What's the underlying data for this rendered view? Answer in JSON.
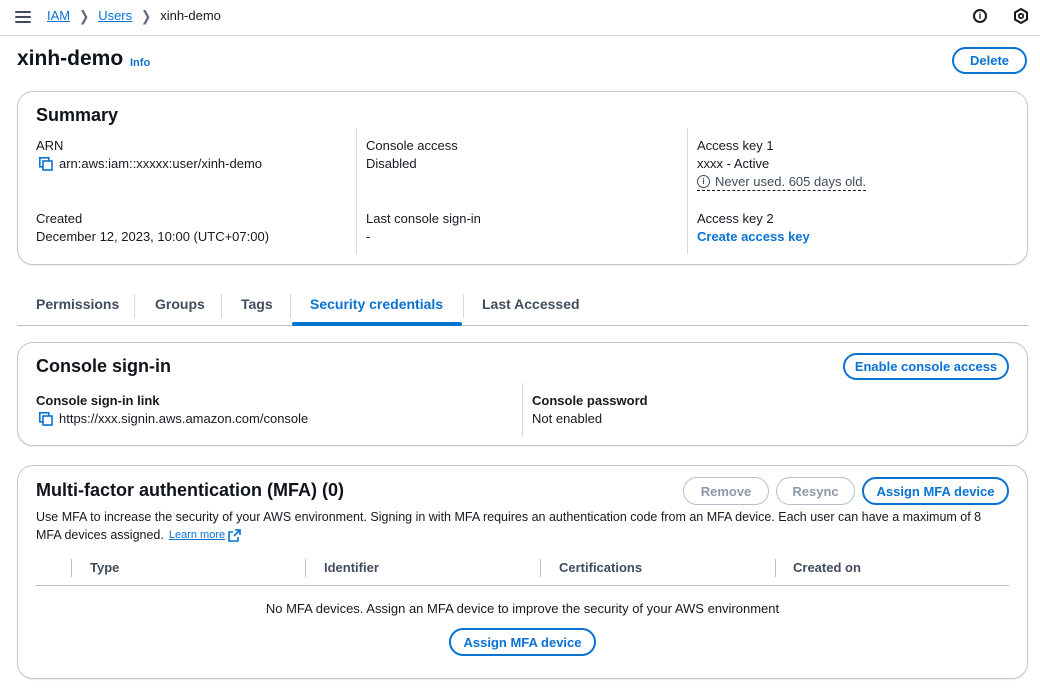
{
  "breadcrumb": {
    "items": [
      "IAM",
      "Users"
    ],
    "current": "xinh-demo"
  },
  "header": {
    "title": "xinh-demo",
    "info_label": "Info",
    "delete_label": "Delete"
  },
  "summary": {
    "title": "Summary",
    "arn_label": "ARN",
    "arn_value": "arn:aws:iam::xxxxx:user/xinh-demo",
    "created_label": "Created",
    "created_value": "December 12, 2023, 10:00 (UTC+07:00)",
    "console_access_label": "Console access",
    "console_access_value": "Disabled",
    "last_signin_label": "Last console sign-in",
    "last_signin_value": "-",
    "access_key1_label": "Access key 1",
    "access_key1_value": "xxxx - Active",
    "access_key1_note": "Never used. 605 days old.",
    "access_key2_label": "Access key 2",
    "create_access_key_label": "Create access key"
  },
  "tabs": [
    {
      "label": "Permissions"
    },
    {
      "label": "Groups"
    },
    {
      "label": "Tags"
    },
    {
      "label": "Security credentials"
    },
    {
      "label": "Last Accessed"
    }
  ],
  "console_signin": {
    "title": "Console sign-in",
    "enable_button": "Enable console access",
    "link_label": "Console sign-in link",
    "link_value": "https://xxx.signin.aws.amazon.com/console",
    "password_label": "Console password",
    "password_value": "Not enabled"
  },
  "mfa": {
    "title": "Multi-factor authentication (MFA) (0)",
    "remove_label": "Remove",
    "resync_label": "Resync",
    "assign_label": "Assign MFA device",
    "description": "Use MFA to increase the security of your AWS environment. Signing in with MFA requires an authentication code from an MFA device. Each user can have a maximum of 8",
    "description_line2": "MFA devices assigned.",
    "learn_more": "Learn more",
    "columns": [
      "Type",
      "Identifier",
      "Certifications",
      "Created on"
    ],
    "empty_message": "No MFA devices. Assign an MFA device to improve the security of your AWS environment",
    "empty_assign_label": "Assign MFA device"
  },
  "colors": {
    "accent": "#0972d3",
    "text": "#16191f",
    "border": "#c6c6cd"
  }
}
